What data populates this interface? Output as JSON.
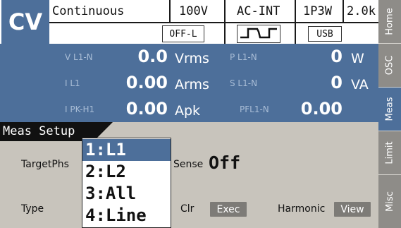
{
  "status": {
    "mode": "CV",
    "output_mode": "Continuous",
    "range": "100V",
    "source": "AC-INT",
    "wiring": "1P3W",
    "freq_range": "2.0k",
    "output_state": "OFF-L",
    "interface": "USB",
    "waveform_icon": "sine-wave-icon"
  },
  "measurements": {
    "row1": {
      "left_label": "V L1-N",
      "left_value": "0.0",
      "left_unit": "Vrms",
      "right_label": "P L1-N",
      "right_value": "0",
      "right_unit": "W"
    },
    "row2": {
      "left_label": "I L1",
      "left_value": "0.00",
      "left_unit": "Arms",
      "right_label": "S L1-N",
      "right_value": "0",
      "right_unit": "VA"
    },
    "row3": {
      "left_label": "I PK-H1",
      "left_value": "0.00",
      "left_unit": "Apk",
      "right_label": "PFL1-N",
      "right_value": "0.00",
      "right_unit": ""
    }
  },
  "setup": {
    "title": "Meas Setup",
    "target_label": "TargetPhs",
    "sense_label": "Sense",
    "sense_value": "Off",
    "type_label": "Type",
    "clr_label": "Clr",
    "exec_button": "Exec",
    "harmonic_label": "Harmonic",
    "view_button": "View"
  },
  "dropdown": {
    "options": [
      "1:L1",
      "2:L2",
      "3:All",
      "4:Line"
    ],
    "selected": "1:L1"
  },
  "side_tabs": [
    "Home",
    "OSC",
    "Meas",
    "Limit",
    "Misc"
  ],
  "colors": {
    "accent": "#4d6f9a",
    "panel_label": "#a9bdd6",
    "background": "#c8c4bc",
    "button": "#7d7b77"
  }
}
